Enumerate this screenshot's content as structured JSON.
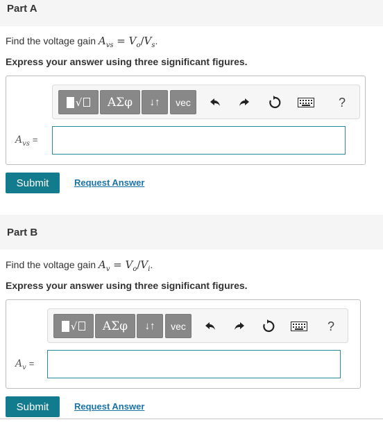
{
  "part_a": {
    "title": "Part A",
    "question_prefix": "Find the voltage gain ",
    "gain_symbol": "A",
    "gain_subscript": "vs",
    "equals": " = ",
    "numerator": "V",
    "numerator_sub": "o",
    "slash": "/",
    "denominator": "V",
    "denominator_sub": "s",
    "period": ".",
    "instruction": "Express your answer using three significant figures.",
    "label_symbol": "A",
    "label_subscript": "vs",
    "label_equals": "=",
    "input_value": "",
    "submit_label": "Submit",
    "request_label": "Request Answer"
  },
  "part_b": {
    "title": "Part B",
    "question_prefix": "Find the voltage gain ",
    "gain_symbol": "A",
    "gain_subscript": "v",
    "equals": " = ",
    "numerator": "V",
    "numerator_sub": "o",
    "slash": "/",
    "denominator": "V",
    "denominator_sub": "i",
    "period": ".",
    "instruction": "Express your answer using three significant figures.",
    "label_symbol": "A",
    "label_subscript": "v",
    "label_equals": "=",
    "input_value": "",
    "submit_label": "Submit",
    "request_label": "Request Answer"
  },
  "toolbar": {
    "greek_label": "ΑΣφ",
    "arrows_label": "↓↑",
    "vec_label": "vec",
    "help_label": "?",
    "icons": [
      "templates-icon",
      "greek-icon",
      "subscript-icon",
      "vec-icon",
      "undo-icon",
      "redo-icon",
      "reset-icon",
      "keyboard-icon",
      "help-icon"
    ]
  },
  "colors": {
    "submit_bg": "#137b8e",
    "link": "#1a73a8",
    "input_border": "#2d8a9a",
    "toolbar_button": "#888888",
    "header_bg": "#f5f5f5"
  }
}
